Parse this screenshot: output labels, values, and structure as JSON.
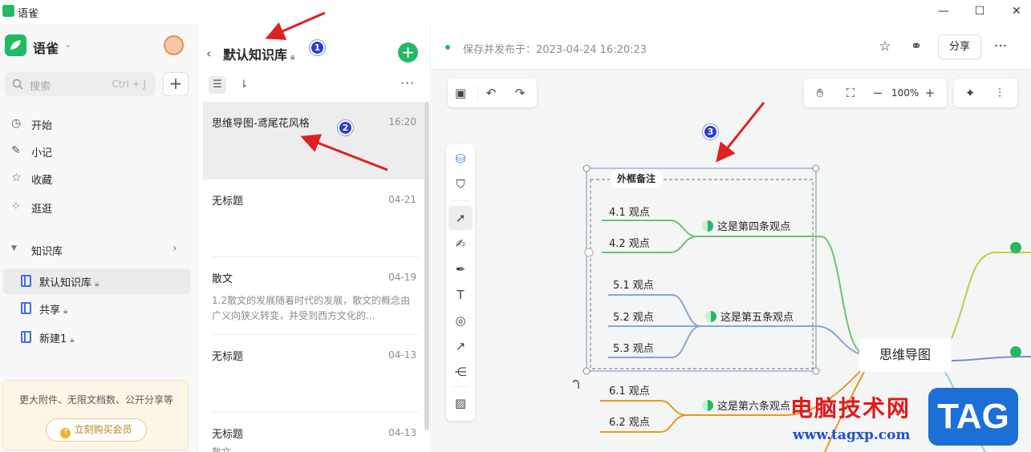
{
  "window": {
    "app_name": "语雀",
    "minimize": "—",
    "maximize": "☐",
    "close": "✕"
  },
  "sidebar": {
    "brand": "语雀",
    "search_placeholder": "搜索",
    "search_shortcut": "Ctrl + J",
    "add_label": "+",
    "nav": [
      {
        "label": "开始",
        "icon": "clock-icon"
      },
      {
        "label": "小记",
        "icon": "feather-icon"
      },
      {
        "label": "收藏",
        "icon": "star-icon"
      },
      {
        "label": "逛逛",
        "icon": "grid-icon"
      }
    ],
    "kb_header": "知识库",
    "kb_items": [
      {
        "label": "默认知识库",
        "active": true
      },
      {
        "label": "共享",
        "active": false
      },
      {
        "label": "新建1",
        "active": false
      }
    ],
    "promo_text": "更大附件、无限文档数、公开分享等",
    "promo_button": "立刻购买会员"
  },
  "doclist": {
    "title": "默认知识库",
    "docs": [
      {
        "title": "思维导图-鸢尾花风格",
        "date": "16:20",
        "snippet": "",
        "active": true
      },
      {
        "title": "无标题",
        "date": "04-21",
        "snippet": "",
        "active": false
      },
      {
        "title": "散文",
        "date": "04-19",
        "snippet": "1.2散文的发展随着时代的发展，散文的概念由广义向狭义转变，并受到西方文化的...",
        "active": false
      },
      {
        "title": "无标题",
        "date": "04-13",
        "snippet": "",
        "active": false
      },
      {
        "title": "无标题",
        "date": "04-13",
        "snippet": "散文...",
        "active": false
      }
    ]
  },
  "editor": {
    "save_status": "保存并发布于：2023-04-24 16:20:23",
    "share_label": "分享",
    "zoom": "100%",
    "mindmap": {
      "root": "思维导图",
      "frame_label": "外框备注",
      "topics": [
        {
          "label": "这是第四条观点",
          "children": [
            "4.1 观点",
            "4.2 观点"
          ]
        },
        {
          "label": "这是第五条观点",
          "children": [
            "5.1 观点",
            "5.2 观点",
            "5.3 观点"
          ]
        },
        {
          "label": "这是第六条观点",
          "children": [
            "6.1 观点",
            "6.2 观点"
          ]
        }
      ]
    }
  },
  "annotations": {
    "badges": [
      "1",
      "2",
      "3"
    ],
    "arrow_color": "#e02020"
  },
  "watermark": {
    "title": "电脑技术网",
    "url": "www.tagxp.com",
    "tag": "TAG"
  },
  "colors": {
    "brand_green": "#25b864",
    "branch_green": "#6cc46f",
    "branch_blue": "#86a9cf",
    "branch_orange": "#e59a1d",
    "branch_yellow": "#c9c940"
  }
}
